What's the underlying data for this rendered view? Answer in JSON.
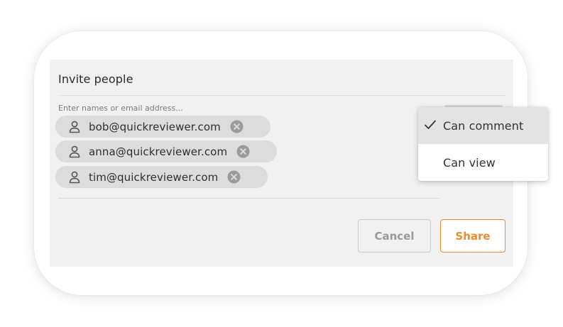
{
  "dialog": {
    "title": "Invite people",
    "field_placeholder": "Enter names or email address..."
  },
  "recipients": [
    {
      "email": "bob@quickreviewer.com",
      "icon": "person-icon",
      "remove_icon": "remove-icon"
    },
    {
      "email": "anna@quickreviewer.com",
      "icon": "person-icon",
      "remove_icon": "remove-icon"
    },
    {
      "email": "tim@quickreviewer.com",
      "icon": "person-icon",
      "remove_icon": "remove-icon"
    }
  ],
  "permission_menu": {
    "items": [
      {
        "label": "Can comment",
        "selected": true,
        "icon": "checkmark-icon"
      },
      {
        "label": "Can view",
        "selected": false
      }
    ]
  },
  "actions": {
    "cancel_label": "Cancel",
    "share_label": "Share"
  },
  "colors": {
    "accent": "#ef8a2a",
    "panel_background": "#f1f1f1",
    "chip_background": "#dcdcdc",
    "menu_selected_background": "#e3e3e3"
  }
}
